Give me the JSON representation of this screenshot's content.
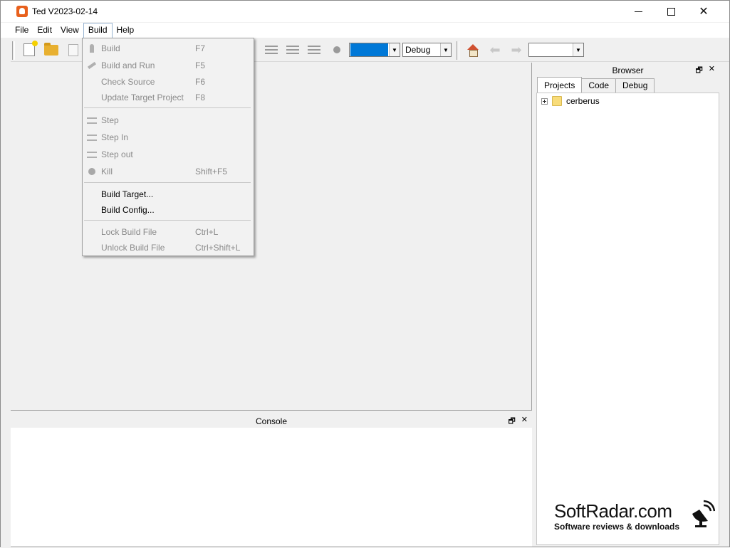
{
  "window": {
    "title": "Ted V2023-02-14",
    "minimize": "",
    "maximize": "",
    "close": "✕"
  },
  "menubar": {
    "items": [
      "File",
      "Edit",
      "View",
      "Build",
      "Help"
    ]
  },
  "toolbar": {
    "target_combo": "",
    "config_combo": "Debug",
    "nav_combo": ""
  },
  "build_menu": {
    "items": [
      {
        "label": "Build",
        "shortcut": "F7",
        "enabled": false,
        "icon": "rocket-icon"
      },
      {
        "label": "Build and Run",
        "shortcut": "F5",
        "enabled": false,
        "icon": "run-icon"
      },
      {
        "label": "Check Source",
        "shortcut": "F6",
        "enabled": false,
        "icon": ""
      },
      {
        "label": "Update Target Project",
        "shortcut": "F8",
        "enabled": false,
        "icon": ""
      },
      {
        "label": "Step",
        "shortcut": "",
        "enabled": false,
        "icon": "step-icon"
      },
      {
        "label": "Step In",
        "shortcut": "",
        "enabled": false,
        "icon": "step-in-icon"
      },
      {
        "label": "Step out",
        "shortcut": "",
        "enabled": false,
        "icon": "step-out-icon"
      },
      {
        "label": "Kill",
        "shortcut": "Shift+F5",
        "enabled": false,
        "icon": "kill-icon"
      },
      {
        "label": "Build Target...",
        "shortcut": "",
        "enabled": true,
        "icon": ""
      },
      {
        "label": "Build Config...",
        "shortcut": "",
        "enabled": true,
        "icon": ""
      },
      {
        "label": "Lock Build File",
        "shortcut": "Ctrl+L",
        "enabled": false,
        "icon": ""
      },
      {
        "label": "Unlock Build File",
        "shortcut": "Ctrl+Shift+L",
        "enabled": false,
        "icon": ""
      }
    ]
  },
  "browser": {
    "title": "Browser",
    "float_icon": "🗗",
    "close_icon": "✕",
    "tabs": [
      "Projects",
      "Code",
      "Debug"
    ],
    "active_tab": "Projects",
    "tree": [
      {
        "label": "cerberus"
      }
    ]
  },
  "console": {
    "title": "Console",
    "float_icon": "🗗",
    "close_icon": "✕"
  },
  "watermark": {
    "title": "SoftRadar.com",
    "subtitle": "Software reviews & downloads"
  },
  "colors": {
    "accent": "#0078d7",
    "menu_highlight_border": "#99b4d1"
  }
}
